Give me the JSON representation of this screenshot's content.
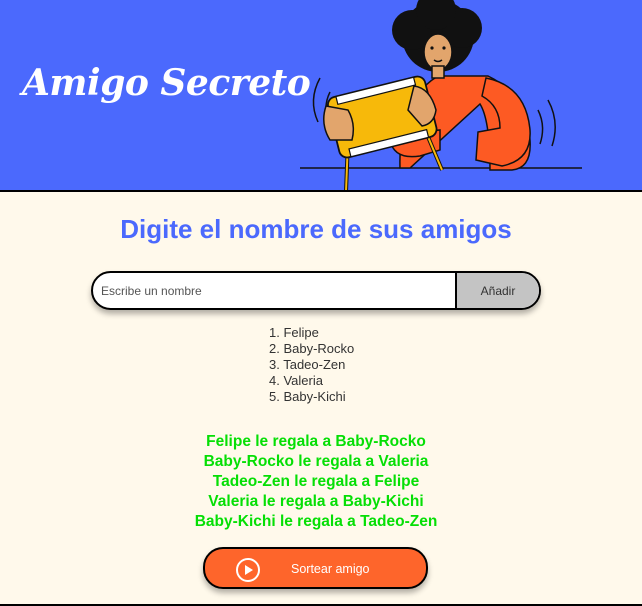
{
  "header": {
    "title": "Amigo Secreto"
  },
  "main": {
    "heading": "Digite el nombre de sus amigos",
    "input": {
      "placeholder": "Escribe un nombre",
      "value": ""
    },
    "add_button": "Añadir",
    "friends": [
      "1. Felipe",
      "2. Baby-Rocko",
      "3. Tadeo-Zen",
      "4. Valeria",
      "5. Baby-Kichi"
    ],
    "results": [
      "Felipe le regala a Baby-Rocko",
      "Baby-Rocko le regala a Valeria",
      "Tadeo-Zen le regala a Felipe",
      "Valeria le regala a Baby-Kichi",
      "Baby-Kichi le regala a Tadeo-Zen"
    ],
    "draw_button": {
      "label": "Sortear amigo",
      "icon": "play-circle-icon"
    }
  },
  "colors": {
    "header_bg": "#4b69fd",
    "page_bg": "#fff9eb",
    "heading": "#4b69fd",
    "result_text": "#05df05",
    "draw_button_bg": "#fe652b",
    "add_button_bg": "#c4c4c4"
  }
}
